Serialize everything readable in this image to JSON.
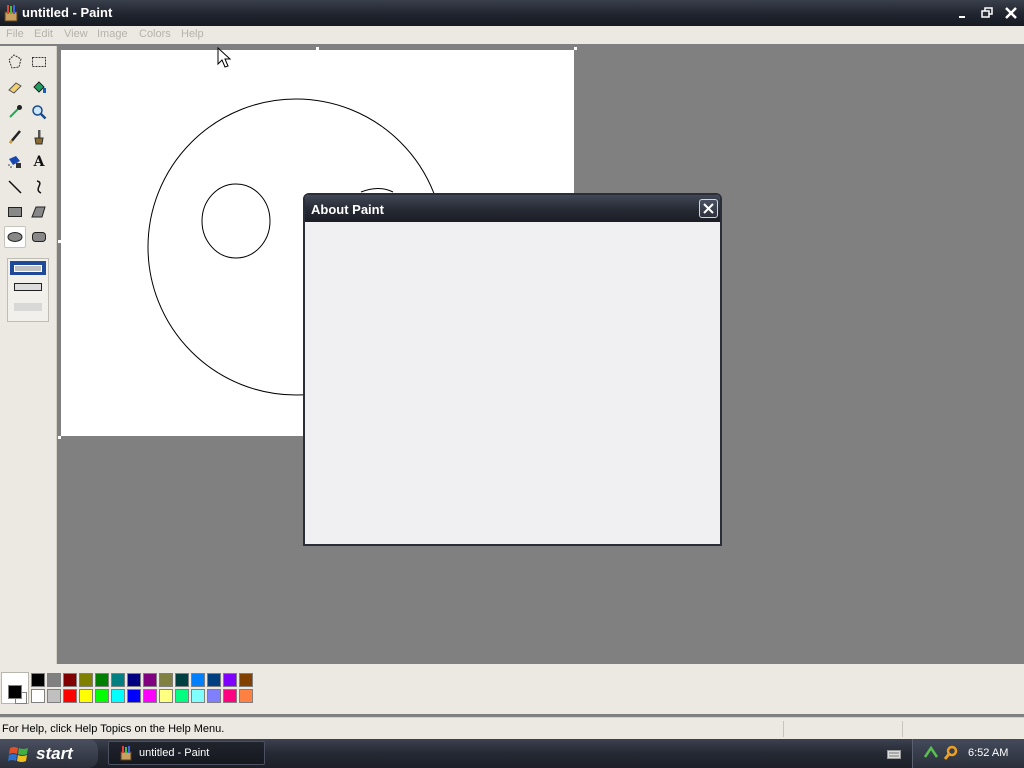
{
  "window": {
    "title": "untitled - Paint",
    "icon": "paint-app-icon",
    "buttons": [
      "minimize-icon",
      "restore-icon",
      "close-icon"
    ]
  },
  "menu": {
    "items": [
      {
        "label": "File"
      },
      {
        "label": "Edit"
      },
      {
        "label": "View"
      },
      {
        "label": "Image"
      },
      {
        "label": "Colors"
      },
      {
        "label": "Help"
      }
    ]
  },
  "tools": [
    {
      "name": "free-form-select",
      "icon": "free-select-icon"
    },
    {
      "name": "select",
      "icon": "rect-select-icon"
    },
    {
      "name": "eraser",
      "icon": "eraser-icon"
    },
    {
      "name": "fill-with-color",
      "icon": "fill-bucket-icon"
    },
    {
      "name": "pick-color",
      "icon": "eyedropper-icon"
    },
    {
      "name": "magnifier",
      "icon": "magnifier-icon"
    },
    {
      "name": "pencil",
      "icon": "pencil-icon"
    },
    {
      "name": "brush",
      "icon": "brush-icon"
    },
    {
      "name": "airbrush",
      "icon": "airbrush-icon"
    },
    {
      "name": "text",
      "icon": "text-icon"
    },
    {
      "name": "line",
      "icon": "line-icon"
    },
    {
      "name": "curve",
      "icon": "curve-icon"
    },
    {
      "name": "rectangle",
      "icon": "rectangle-icon"
    },
    {
      "name": "polygon",
      "icon": "polygon-icon"
    },
    {
      "name": "ellipse",
      "icon": "ellipse-icon",
      "selected": true
    },
    {
      "name": "rounded-rectangle",
      "icon": "rounded-rect-icon"
    }
  ],
  "text_tool_glyph": "A",
  "palette": {
    "foreground": "#000000",
    "background": "#ffffff",
    "top_row": [
      "#000000",
      "#808080",
      "#800000",
      "#808000",
      "#008000",
      "#008080",
      "#000080",
      "#800080",
      "#808040",
      "#004040",
      "#0080ff",
      "#004080",
      "#8000ff",
      "#804000"
    ],
    "bottom_row": [
      "#ffffff",
      "#c0c0c0",
      "#ff0000",
      "#ffff00",
      "#00ff00",
      "#00ffff",
      "#0000ff",
      "#ff00ff",
      "#ffff80",
      "#00ff80",
      "#80ffff",
      "#8080ff",
      "#ff0080",
      "#ff8040"
    ]
  },
  "status": {
    "text": "For Help, click Help Topics on the Help Menu."
  },
  "dialog": {
    "title": "About Paint",
    "close_icon": "close-icon"
  },
  "taskbar": {
    "start_label": "start",
    "task_label": "untitled - Paint",
    "clock": "6:52 AM",
    "tray_icons": [
      "keyboard-icon",
      "network-icon",
      "search-icon"
    ]
  }
}
